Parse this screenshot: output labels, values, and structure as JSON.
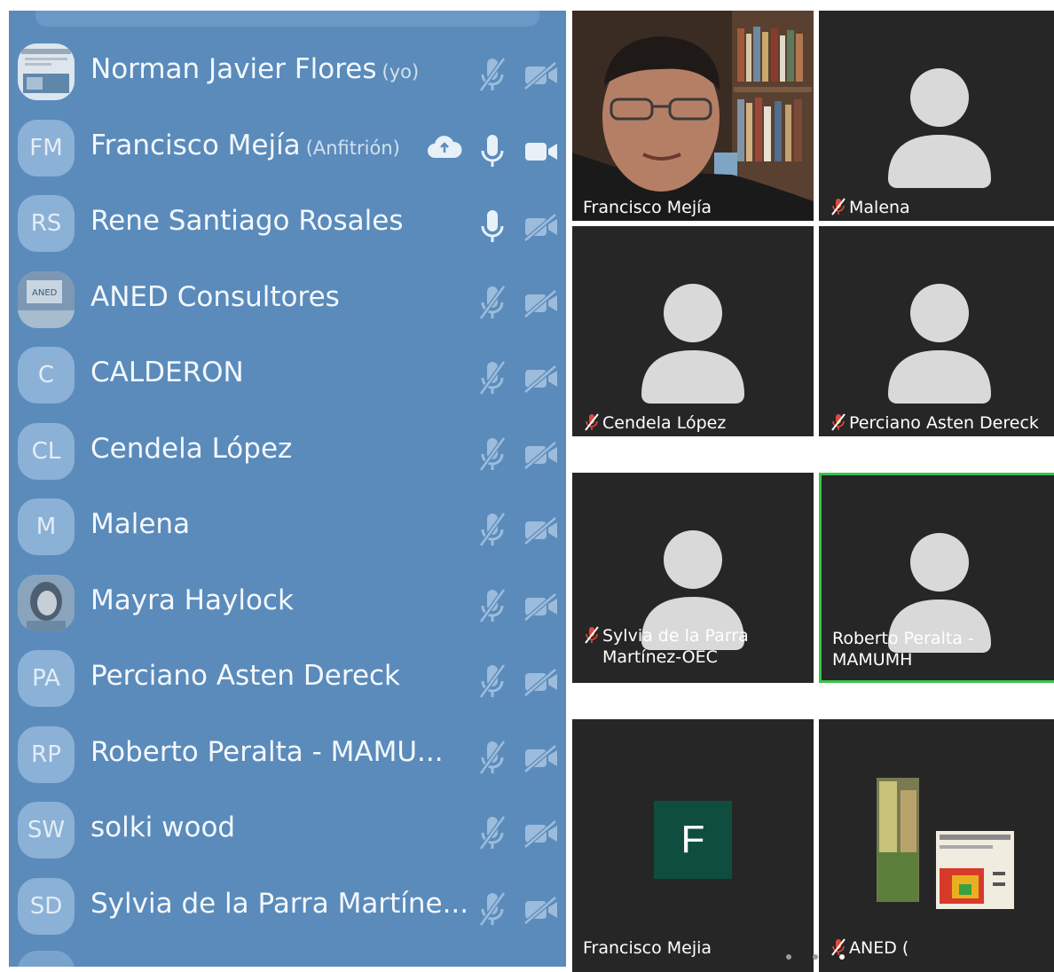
{
  "participants": [
    {
      "initials": "",
      "avatar": "photo-newsletter",
      "name": "Norman Javier Flores",
      "tag": "(yo)",
      "mic": "off",
      "cam": "off",
      "cloud": false
    },
    {
      "initials": "FM",
      "name": "Francisco Mejía",
      "tag": "(Anfitrión)",
      "mic": "on",
      "cam": "on",
      "cloud": true
    },
    {
      "initials": "RS",
      "name": "Rene Santiago Rosales",
      "tag": "",
      "mic": "on",
      "cam": "off",
      "cloud": false
    },
    {
      "initials": "",
      "avatar": "photo-sign",
      "name": "ANED Consultores",
      "tag": "",
      "mic": "off",
      "cam": "off",
      "cloud": false
    },
    {
      "initials": "C",
      "name": "CALDERON",
      "tag": "",
      "mic": "off",
      "cam": "off",
      "cloud": false
    },
    {
      "initials": "CL",
      "name": "Cendela López",
      "tag": "",
      "mic": "off",
      "cam": "off",
      "cloud": false
    },
    {
      "initials": "M",
      "name": "Malena",
      "tag": "",
      "mic": "off",
      "cam": "off",
      "cloud": false
    },
    {
      "initials": "",
      "avatar": "photo-person",
      "name": "Mayra Haylock",
      "tag": "",
      "mic": "off",
      "cam": "off",
      "cloud": false
    },
    {
      "initials": "PA",
      "name": "Perciano Asten Dereck",
      "tag": "",
      "mic": "off",
      "cam": "off",
      "cloud": false
    },
    {
      "initials": "RP",
      "name": "Roberto Peralta - MAMU...",
      "tag": "",
      "mic": "off",
      "cam": "off",
      "cloud": false
    },
    {
      "initials": "SW",
      "name": "solki wood",
      "tag": "",
      "mic": "off",
      "cam": "off",
      "cloud": false
    },
    {
      "initials": "SD",
      "name": "Sylvia de la Parra Martíne...",
      "tag": "",
      "mic": "off",
      "cam": "off",
      "cloud": false
    }
  ],
  "tiles": [
    {
      "kind": "video",
      "name": "Francisco Mejía",
      "muted": false
    },
    {
      "kind": "placeholder",
      "name": "Malena",
      "muted": true
    },
    {
      "kind": "placeholder",
      "name": "Cendela López",
      "muted": true
    },
    {
      "kind": "placeholder",
      "name": "Perciano Asten Dereck",
      "muted": true
    },
    {
      "kind": "placeholder",
      "name": "Sylvia de la Parra",
      "name2": "Martínez-OEC",
      "muted": true
    },
    {
      "kind": "placeholder",
      "name": "Roberto Peralta -",
      "name2": "MAMUMH",
      "muted": false,
      "active": true
    },
    {
      "kind": "letter",
      "letter": "F",
      "name": "Francisco Mejia",
      "muted": false
    },
    {
      "kind": "share",
      "name": "ANED (",
      "muted": true
    }
  ],
  "colors": {
    "panel": "#5a8bbb",
    "tile": "#262626",
    "active_border": "#36c24a",
    "letter_avatar": "#0f4e3e"
  }
}
